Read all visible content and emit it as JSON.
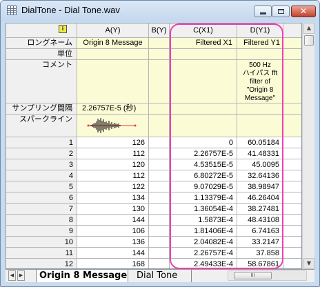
{
  "window": {
    "title": "DialTone - Dial Tone.wav"
  },
  "controls": {
    "min": "",
    "max": "",
    "close": "✕"
  },
  "columns": [
    {
      "name": "A(Y)"
    },
    {
      "name": "B(Y)"
    },
    {
      "name": "C(X1)"
    },
    {
      "name": "D(Y1)"
    }
  ],
  "row_labels": {
    "long_name": "ロングネーム",
    "units": "単位",
    "comments": "コメント",
    "sampling_interval": "サンプリング間隔",
    "sparklines": "スパークライン"
  },
  "metadata": {
    "a_long_name": "Origin 8 Message",
    "c_long_name": "Filtered X1",
    "d_long_name": "Filtered Y1",
    "d_comment": "500 Hz\nハイパス fft\nfilter of\n\"Origin 8\nMessage\"",
    "a_sampling_interval": "2.26757E-5 (秒)"
  },
  "rows": [
    {
      "n": "1",
      "a": "126",
      "c": "0",
      "d": "60.05184"
    },
    {
      "n": "2",
      "a": "112",
      "c": "2.26757E-5",
      "d": "41.48331"
    },
    {
      "n": "3",
      "a": "120",
      "c": "4.53515E-5",
      "d": "45.0095"
    },
    {
      "n": "4",
      "a": "112",
      "c": "6.80272E-5",
      "d": "32.64136"
    },
    {
      "n": "5",
      "a": "122",
      "c": "9.07029E-5",
      "d": "38.98947"
    },
    {
      "n": "6",
      "a": "134",
      "c": "1.13379E-4",
      "d": "46.26404"
    },
    {
      "n": "7",
      "a": "130",
      "c": "1.36054E-4",
      "d": "38.27481"
    },
    {
      "n": "8",
      "a": "144",
      "c": "1.5873E-4",
      "d": "48.43108"
    },
    {
      "n": "9",
      "a": "106",
      "c": "1.81406E-4",
      "d": "6.74163"
    },
    {
      "n": "10",
      "a": "136",
      "c": "2.04082E-4",
      "d": "33.2147"
    },
    {
      "n": "11",
      "a": "144",
      "c": "2.26757E-4",
      "d": "37.858"
    },
    {
      "n": "12",
      "a": "168",
      "c": "2.49433E-4",
      "d": "58.67861"
    }
  ],
  "tabs": {
    "active": "Origin 8 Message",
    "inactive": "Dial Tone"
  },
  "scrollbar": {
    "grip": "III"
  },
  "colors": {
    "highlight": "#ee3fb0",
    "meta_bg": "#fbfbd5"
  }
}
